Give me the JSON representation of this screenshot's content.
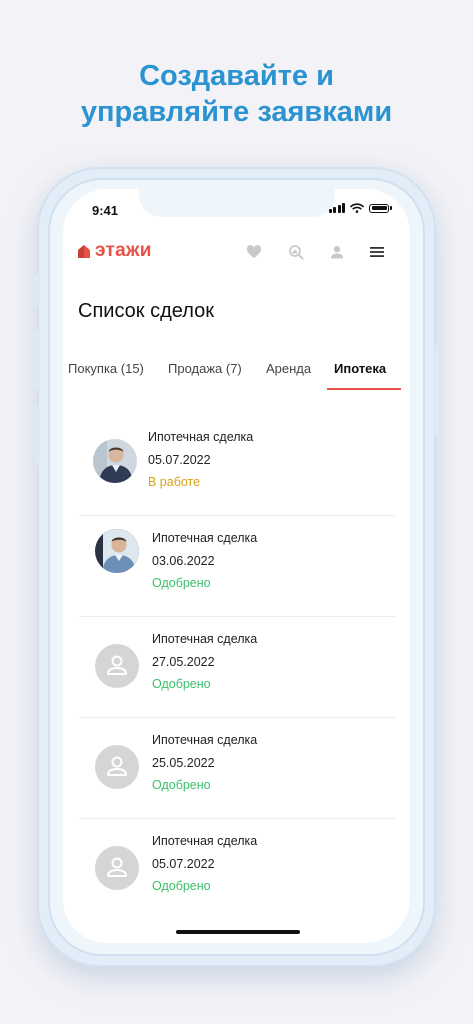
{
  "headline": {
    "line1": "Создавайте и",
    "line2": "управляйте заявками"
  },
  "status_bar": {
    "time": "9:41"
  },
  "header": {
    "logo_text": "этажи",
    "icons": [
      "heart-icon",
      "search-house-icon",
      "user-icon",
      "menu-icon"
    ]
  },
  "page": {
    "title": "Список сделок"
  },
  "tabs": [
    {
      "label": "Покупка (15)"
    },
    {
      "label": "Продажа (7)"
    },
    {
      "label": "Аренда"
    },
    {
      "label": "Ипотека",
      "active": true
    }
  ],
  "deals": [
    {
      "title": "Ипотечная сделка",
      "date": "05.07.2022",
      "status": "В работе",
      "status_color": "#d4a21a",
      "avatar": "photo"
    },
    {
      "title": "Ипотечная сделка",
      "date": "03.06.2022",
      "status": "Одобрено",
      "status_color": "#3cbf6a",
      "avatar": "photo"
    },
    {
      "title": "Ипотечная сделка",
      "date": "27.05.2022",
      "status": "Одобрено",
      "status_color": "#3cbf6a",
      "avatar": "placeholder"
    },
    {
      "title": "Ипотечная сделка",
      "date": "25.05.2022",
      "status": "Одобрено",
      "status_color": "#3cbf6a",
      "avatar": "placeholder"
    },
    {
      "title": "Ипотечная сделка",
      "date": "05.07.2022",
      "status": "Одобрено",
      "status_color": "#3cbf6a",
      "avatar": "placeholder"
    }
  ],
  "colors": {
    "brand": "#e85246",
    "headline": "#2b93d1",
    "in_progress": "#d4a21a",
    "approved": "#3cbf6a"
  }
}
